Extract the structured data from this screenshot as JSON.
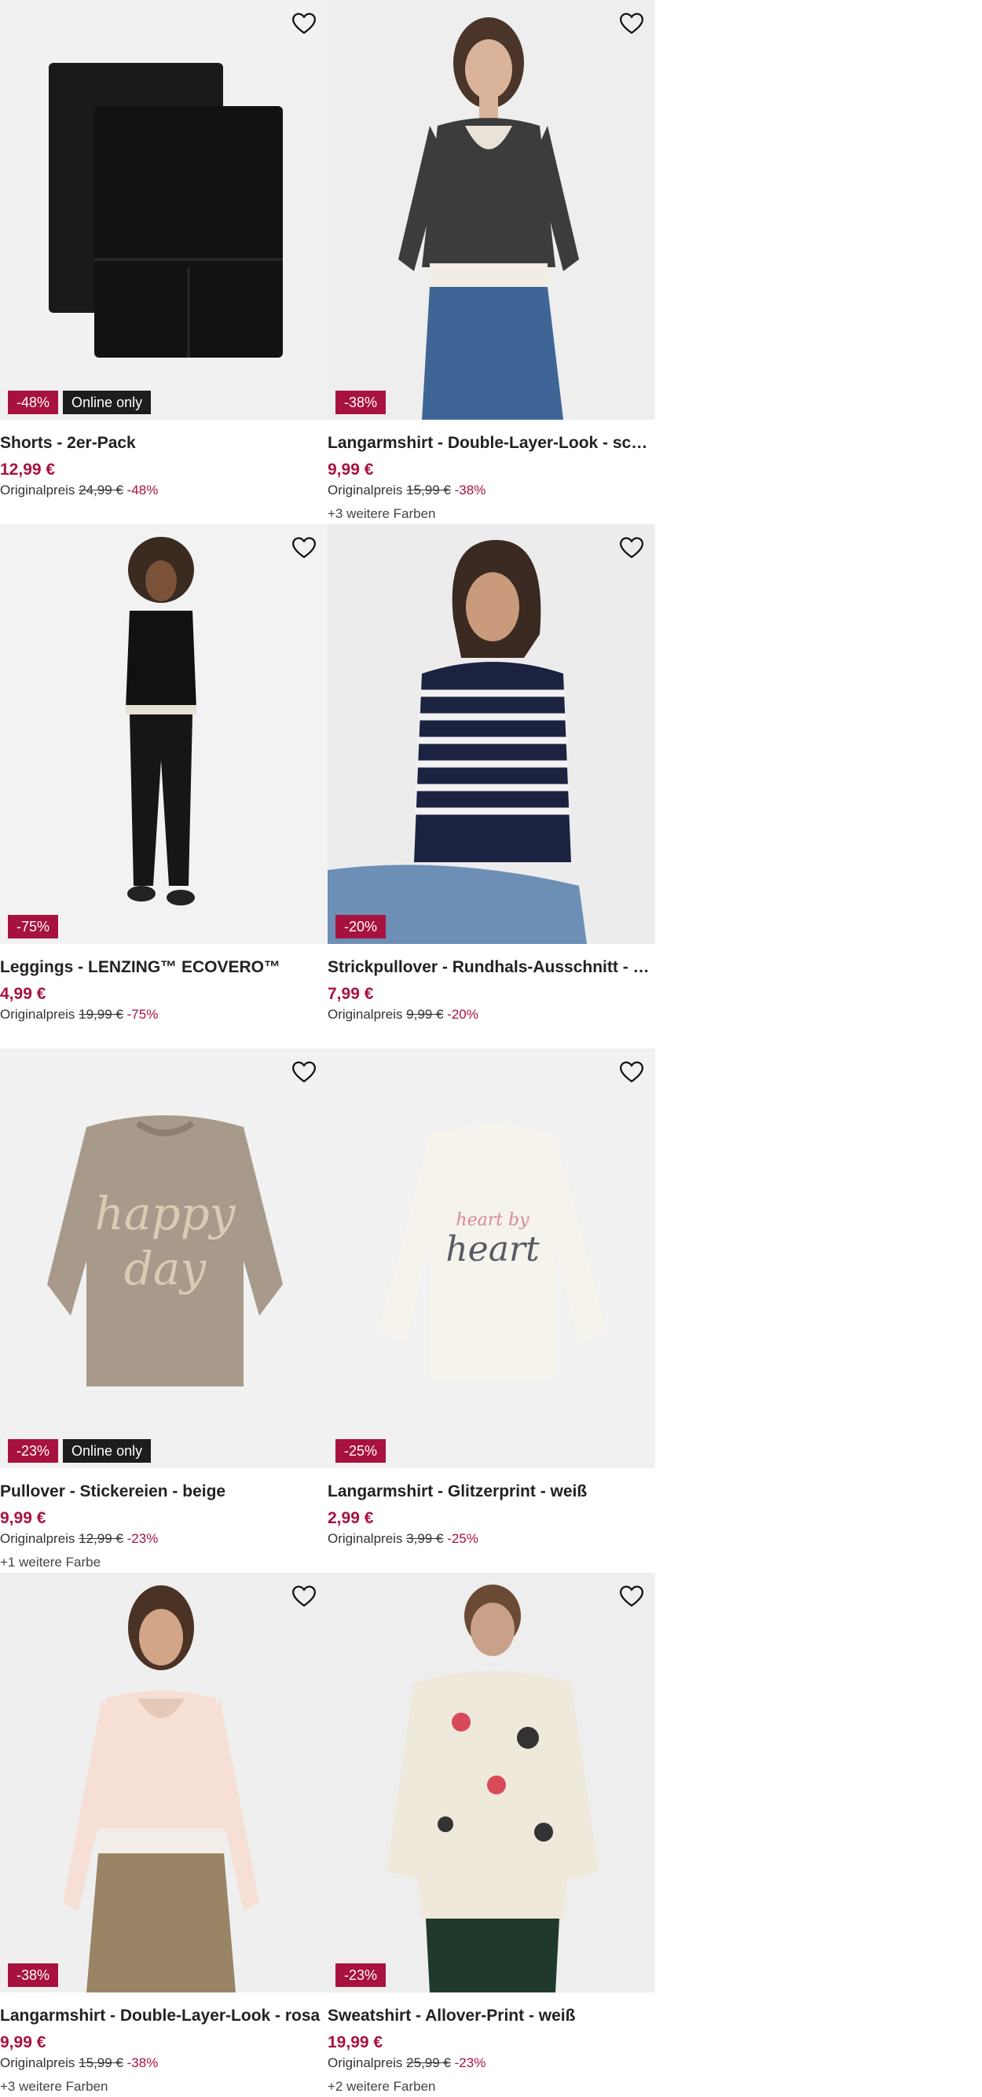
{
  "products": [
    {
      "name": "Shorts - 2er-Pack",
      "price": "12,99 €",
      "original_label": "Originalpreis",
      "original_price": "24,99 €",
      "discount": "-48%",
      "badge_sale": "-48%",
      "badge_online": "Online only",
      "colors": ""
    },
    {
      "name": "Langarmshirt - Double-Layer-Look - schwarz",
      "price": "9,99 €",
      "original_label": "Originalpreis",
      "original_price": "15,99 €",
      "discount": "-38%",
      "badge_sale": "-38%",
      "badge_online": "",
      "colors": "+3 weitere Farben"
    },
    {
      "name": "Leggings - LENZING™ ECOVERO™",
      "price": "4,99 €",
      "original_label": "Originalpreis",
      "original_price": "19,99 €",
      "discount": "-75%",
      "badge_sale": "-75%",
      "badge_online": "",
      "colors": ""
    },
    {
      "name": "Strickpullover - Rundhals-Ausschnitt - dunk...",
      "price": "7,99 €",
      "original_label": "Originalpreis",
      "original_price": "9,99 €",
      "discount": "-20%",
      "badge_sale": "-20%",
      "badge_online": "",
      "colors": ""
    },
    {
      "name": "Pullover - Stickereien - beige",
      "price": "9,99 €",
      "original_label": "Originalpreis",
      "original_price": "12,99 €",
      "discount": "-23%",
      "badge_sale": "-23%",
      "badge_online": "Online only",
      "colors": "+1 weitere Farbe"
    },
    {
      "name": "Langarmshirt - Glitzerprint - weiß",
      "price": "2,99 €",
      "original_label": "Originalpreis",
      "original_price": "3,99 €",
      "discount": "-25%",
      "badge_sale": "-25%",
      "badge_online": "",
      "colors": ""
    },
    {
      "name": "Langarmshirt - Double-Layer-Look - rosa",
      "price": "9,99 €",
      "original_label": "Originalpreis",
      "original_price": "15,99 €",
      "discount": "-38%",
      "badge_sale": "-38%",
      "badge_online": "",
      "colors": "+3 weitere Farben"
    },
    {
      "name": "Sweatshirt - Allover-Print - weiß",
      "price": "19,99 €",
      "original_label": "Originalpreis",
      "original_price": "25,99 €",
      "discount": "-23%",
      "badge_sale": "-23%",
      "badge_online": "",
      "colors": "+2 weitere Farben"
    }
  ],
  "colors": {
    "sale": "#a8123e",
    "online_badge": "#1d1d1d",
    "image_bg": "#f1f1f1"
  },
  "icons": {
    "wishlist": "heart-icon"
  }
}
